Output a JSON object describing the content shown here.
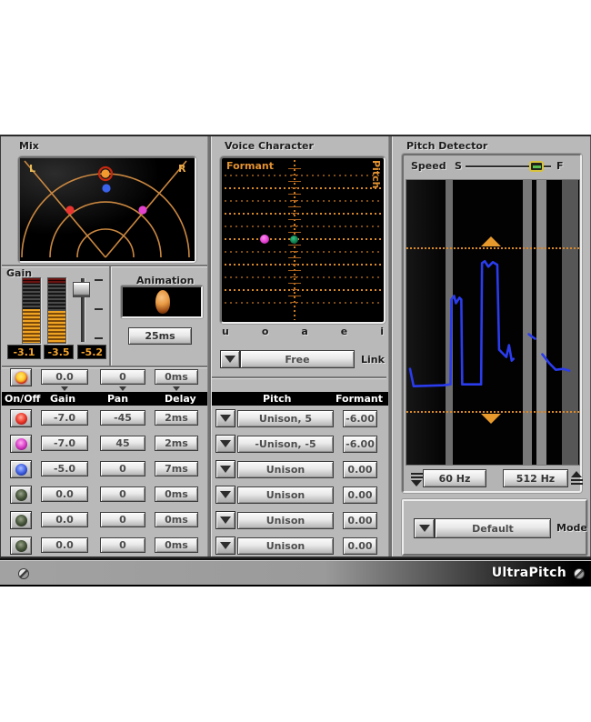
{
  "window": {
    "brand": "UltraPitch"
  },
  "mix": {
    "title": "Mix",
    "left_label": "L",
    "right_label": "R"
  },
  "gain": {
    "title": "Gain",
    "readouts": [
      "-3.1",
      "-3.5",
      "-5.2"
    ]
  },
  "animation": {
    "title": "Animation",
    "rate_button": "25ms"
  },
  "master_row": {
    "gain": "0.0",
    "pan": "0",
    "delay": "0ms"
  },
  "voice_table": {
    "headers": {
      "on_off": "On/Off",
      "gain": "Gain",
      "pan": "Pan",
      "delay": "Delay"
    },
    "rows": [
      {
        "led": "red",
        "gain": "-7.0",
        "pan": "-45",
        "delay": "2ms"
      },
      {
        "led": "magenta",
        "gain": "-7.0",
        "pan": "45",
        "delay": "2ms"
      },
      {
        "led": "blue",
        "gain": "-5.0",
        "pan": "0",
        "delay": "7ms"
      },
      {
        "led": "off",
        "gain": "0.0",
        "pan": "0",
        "delay": "0ms"
      },
      {
        "led": "off",
        "gain": "0.0",
        "pan": "0",
        "delay": "0ms"
      },
      {
        "led": "off",
        "gain": "0.0",
        "pan": "0",
        "delay": "0ms"
      }
    ]
  },
  "voice_character": {
    "title": "Voice Character",
    "formant_label": "Formant",
    "pitch_label": "Pitch",
    "vowels": [
      "u",
      "o",
      "a",
      "e",
      "i"
    ],
    "mode_value": "Free",
    "link_label": "Link"
  },
  "pitch_table": {
    "pitch_header": "Pitch",
    "formant_header": "Formant",
    "rows": [
      {
        "pitch": "Unison, 5",
        "formant": "-6.00"
      },
      {
        "pitch": "-Unison, -5",
        "formant": "-6.00"
      },
      {
        "pitch": "Unison",
        "formant": "0.00"
      },
      {
        "pitch": "Unison",
        "formant": "0.00"
      },
      {
        "pitch": "Unison",
        "formant": "0.00"
      },
      {
        "pitch": "Unison",
        "formant": "0.00"
      }
    ]
  },
  "pitch_detector": {
    "title": "Pitch Detector",
    "speed_label": "Speed",
    "slow_label": "S",
    "fast_label": "F",
    "low_freq_button": "60 Hz",
    "high_freq_button": "512 Hz",
    "mode_label": "Mode",
    "mode_value": "Default",
    "curve_main": "4,207 8,226 41,225 49,224 50,131 53,127 55,135 59,129 61,131 62,224 83,224 84,91 87,89 91,95 96,90 101,93 103,186 111,194 114,181 117,198 119,196",
    "curve_seg2": "136,169 140,172 143,174",
    "curve_seg3": "151,191 159,201 166,208 174,207 181,209"
  },
  "colors": {
    "orange_accent": "#e8992c",
    "display_line_orange": "#d9882a",
    "curve_blue": "#2a3cee",
    "led_red": "#e03030",
    "led_magenta": "#de46ce",
    "led_blue": "#4868e8",
    "led_off_green": "#4c5a40",
    "led_master_yellow": "#ffcf2e",
    "meter_orange": "#f0a424",
    "readout_orange": "#f2a22c"
  }
}
